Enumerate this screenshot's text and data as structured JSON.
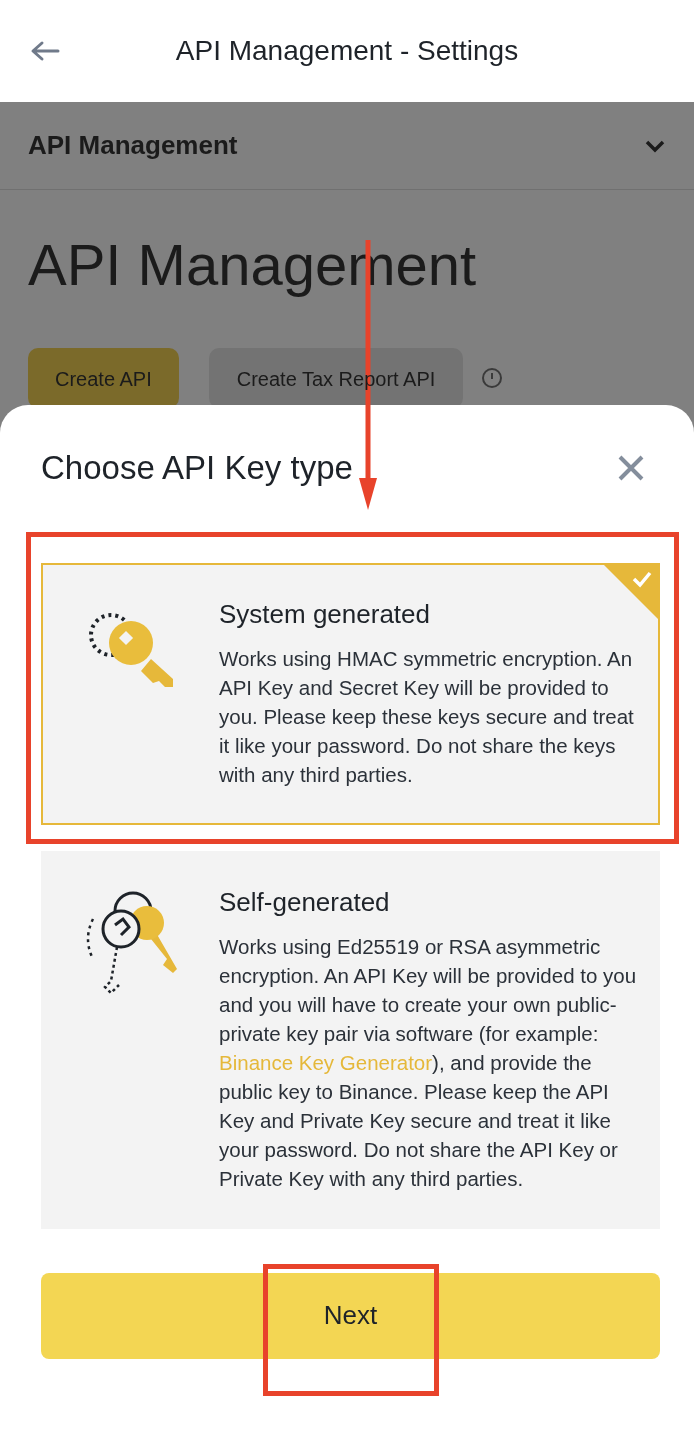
{
  "header": {
    "title": "API Management - Settings"
  },
  "background": {
    "section": "API Management",
    "heading": "API Management",
    "buttons": [
      {
        "label": "Create API",
        "kind": "primary"
      },
      {
        "label": "Create Tax Report API",
        "kind": "secondary"
      }
    ]
  },
  "sheet": {
    "title": "Choose API Key type",
    "options": [
      {
        "title": "System generated",
        "selected": true,
        "description": [
          {
            "text": "Works using HMAC symmetric encryption. An API Key and Secret Key will be provided to you. Please keep these keys secure and treat it like your password. Do not share the keys with any third parties.",
            "kind": "text"
          }
        ]
      },
      {
        "title": "Self-generated",
        "selected": false,
        "description": [
          {
            "text": "Works using Ed25519 or RSA asymmetric encryption. An API Key will be provided to you and you will have to create your own public-private key pair via software (for example: ",
            "kind": "text"
          },
          {
            "text": "Binance Key Generator",
            "kind": "link"
          },
          {
            "text": "), and provide the public key to Binance. Please keep the API Key and Private Key secure and treat it like your password. Do not share the API Key or Private Key with any third parties.",
            "kind": "text"
          }
        ]
      }
    ],
    "next": "Next"
  }
}
